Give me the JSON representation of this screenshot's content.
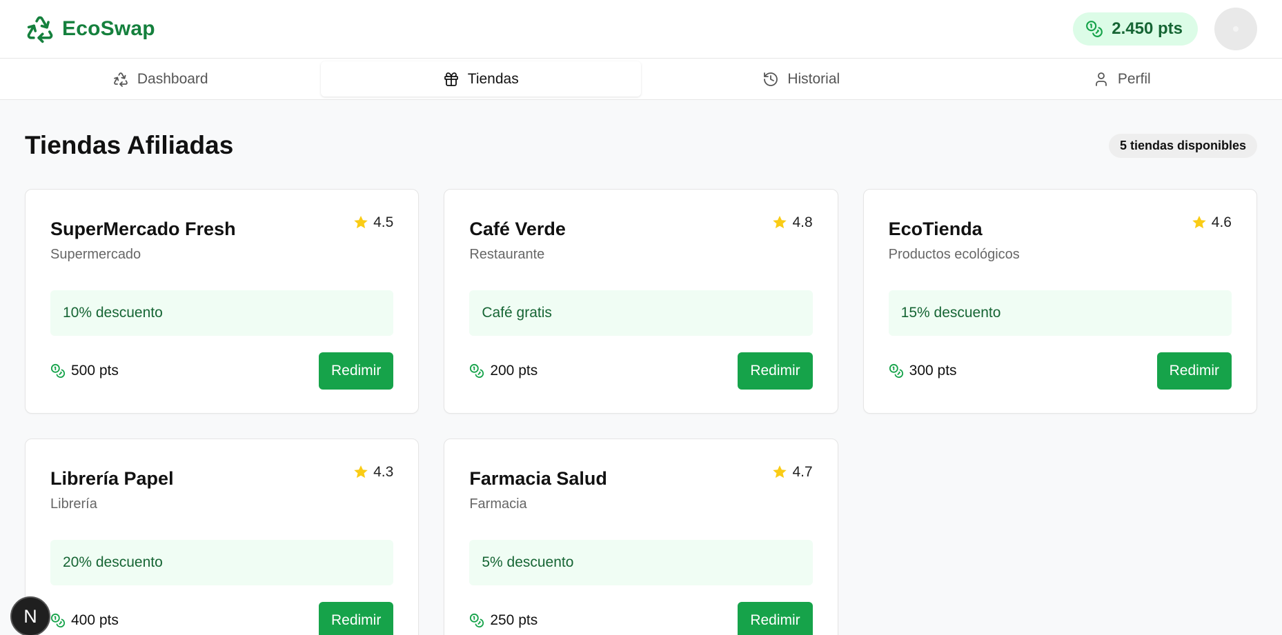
{
  "app": {
    "name": "EcoSwap",
    "points": "2.450 pts"
  },
  "nav": {
    "tabs": [
      {
        "label": "Dashboard",
        "icon": "recycle-icon"
      },
      {
        "label": "Tiendas",
        "icon": "gift-icon",
        "active": true
      },
      {
        "label": "Historial",
        "icon": "history-icon"
      },
      {
        "label": "Perfil",
        "icon": "user-icon"
      }
    ]
  },
  "page": {
    "title": "Tiendas Afiliadas",
    "count": "5 tiendas disponibles"
  },
  "stores": [
    {
      "name": "SuperMercado Fresh",
      "rating": "4.5",
      "category": "Supermercado",
      "offer": "10% descuento",
      "cost": "500 pts",
      "button": "Redimir"
    },
    {
      "name": "Café Verde",
      "rating": "4.8",
      "category": "Restaurante",
      "offer": "Café gratis",
      "cost": "200 pts",
      "button": "Redimir"
    },
    {
      "name": "EcoTienda",
      "rating": "4.6",
      "category": "Productos ecológicos",
      "offer": "15% descuento",
      "cost": "300 pts",
      "button": "Redimir"
    },
    {
      "name": "Librería Papel",
      "rating": "4.3",
      "category": "Librería",
      "offer": "20% descuento",
      "cost": "400 pts",
      "button": "Redimir"
    },
    {
      "name": "Farmacia Salud",
      "rating": "4.7",
      "category": "Farmacia",
      "offer": "5% descuento",
      "cost": "250 pts",
      "button": "Redimir"
    }
  ],
  "dev_badge": "N",
  "colors": {
    "brand": "#15803d",
    "accent": "#16a34a",
    "offer_bg": "#f0fdf4",
    "star": "#facc15"
  }
}
